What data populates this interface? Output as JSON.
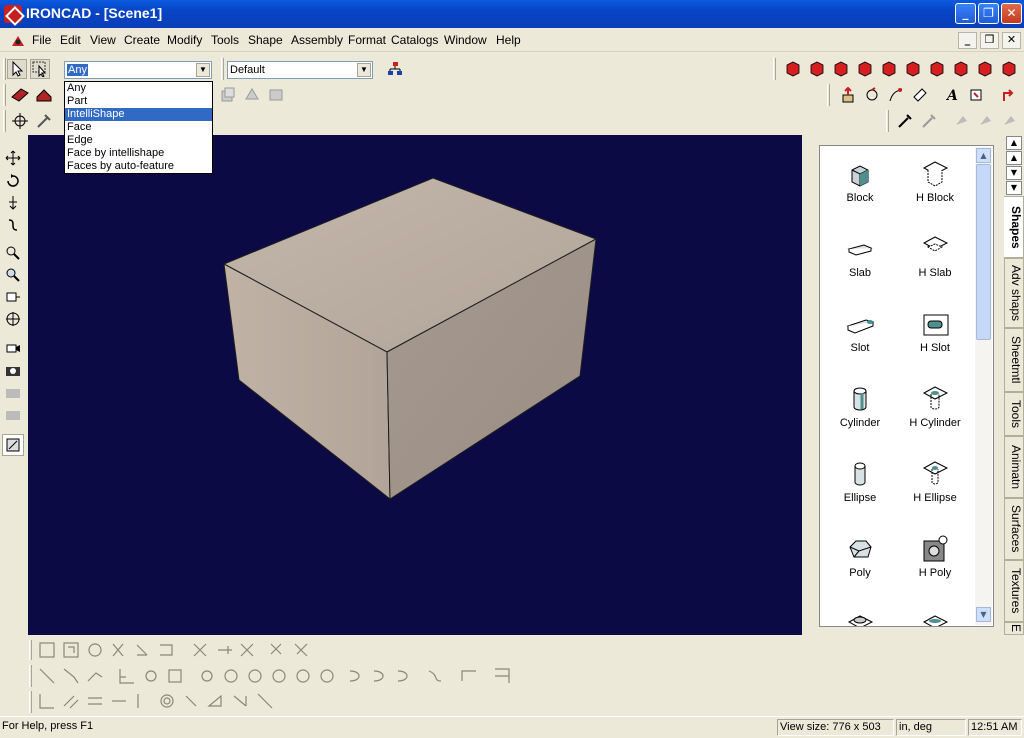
{
  "window": {
    "title": "IRONCAD - [Scene1]",
    "minimize": "_",
    "maximize": "❐",
    "close": "✕"
  },
  "menu": [
    "File",
    "Edit",
    "View",
    "Create",
    "Modify",
    "Tools",
    "Shape",
    "Assembly",
    "Format",
    "Catalogs",
    "Window",
    "Help"
  ],
  "mdi_controls": [
    "_",
    "❐",
    "✕"
  ],
  "selection_filter": {
    "value": "Any",
    "options": [
      "Any",
      "Part",
      "IntelliShape",
      "Face",
      "Edge",
      "Face by intellishape",
      "Faces by auto-feature"
    ],
    "highlighted": "IntelliShape"
  },
  "style_combo": {
    "value": "Default"
  },
  "catalog": {
    "shapes": [
      {
        "label": "Block",
        "icon": "block-icon"
      },
      {
        "label": "H Block",
        "icon": "h-block-icon"
      },
      {
        "label": "Slab",
        "icon": "slab-icon"
      },
      {
        "label": "H Slab",
        "icon": "h-slab-icon"
      },
      {
        "label": "Slot",
        "icon": "slot-icon"
      },
      {
        "label": "H Slot",
        "icon": "h-slot-icon"
      },
      {
        "label": "Cylinder",
        "icon": "cylinder-icon"
      },
      {
        "label": "H Cylinder",
        "icon": "h-cylinder-icon"
      },
      {
        "label": "Ellipse",
        "icon": "ellipse-icon"
      },
      {
        "label": "H Ellipse",
        "icon": "h-ellipse-icon"
      },
      {
        "label": "Poly",
        "icon": "poly-icon"
      },
      {
        "label": "H Poly",
        "icon": "h-poly-icon"
      }
    ],
    "tabs": [
      "Shapes",
      "Adv shaps",
      "Sheetmtl",
      "Tools",
      "Animatn",
      "Surfaces",
      "Textures",
      "E"
    ]
  },
  "status": {
    "help": "For Help, press F1",
    "view_size": "View size:  776 x  503",
    "units": "in, deg",
    "clock": "12:51 AM"
  },
  "colors": {
    "viewport_bg": "#0b0a45",
    "box_face": "#b4a89c",
    "titlebar": "#0a4fd8"
  }
}
